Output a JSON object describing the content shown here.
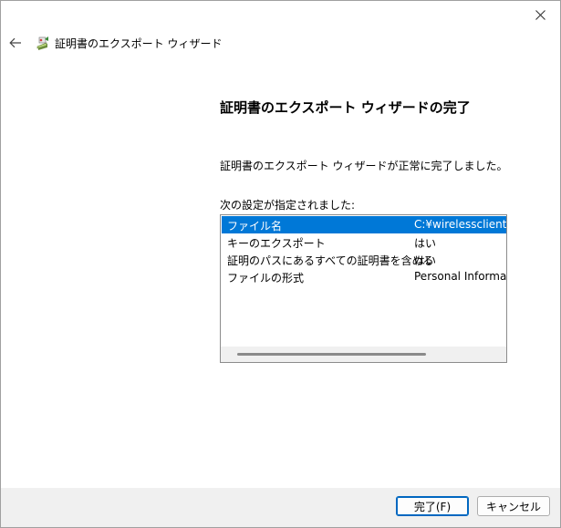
{
  "window": {
    "title": "証明書のエクスポート ウィザード"
  },
  "page": {
    "heading": "証明書のエクスポート ウィザードの完了",
    "status": "証明書のエクスポート ウィザードが正常に完了しました。",
    "settings_label": "次の設定が指定されました:"
  },
  "settings": {
    "rows": [
      {
        "name": "ファイル名",
        "value": "C:¥wirelessclient.pf",
        "selected": true
      },
      {
        "name": "キーのエクスポート",
        "value": "はい",
        "selected": false
      },
      {
        "name": "証明のパスにあるすべての証明書を含める",
        "value": "はい",
        "selected": false
      },
      {
        "name": "ファイルの形式",
        "value": "Personal Informatic",
        "selected": false
      }
    ]
  },
  "buttons": {
    "finish": "完了(F)",
    "cancel": "キャンセル"
  },
  "icons": {
    "close": "close-icon",
    "back": "back-arrow-icon",
    "wizard": "certificate-wizard-icon"
  },
  "colors": {
    "selection": "#0078d7",
    "footer": "#f0f0f0",
    "primary_border": "#0067c0"
  }
}
